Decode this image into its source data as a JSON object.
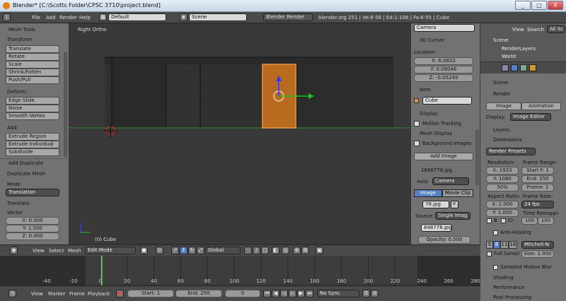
{
  "title": "Blender* [C:\\Scotts Folder\\CPSC 3710\\project.blend]",
  "win": {
    "min": "_",
    "max": "□",
    "close": "X"
  },
  "menu": [
    "File",
    "Add",
    "Render",
    "Help"
  ],
  "layout_name": "Default",
  "scene_name": "Scene",
  "engine": "Blender Render",
  "stats": "blender.org 251 | Ve:8-58 | Ed:1-106 | Fa:6-55 | Cube",
  "left": {
    "mesh_tools": "Mesh Tools",
    "transform_label": "Transform:",
    "transform": [
      "Translate",
      "Rotate",
      "Scale",
      "Shrink/Fatten",
      "Push/Pull"
    ],
    "deform_label": "Deform:",
    "deform": [
      "Edge Slide",
      "Noise",
      "Smooth Vertex"
    ],
    "add_label": "Add:",
    "add": [
      "Extrude Region",
      "Extrude Individual",
      "Subdivide"
    ],
    "op_header": "Add Duplicate",
    "op_name": "Duplicate Mesh",
    "mode_label": "Mode",
    "mode_val": "Translation",
    "translate_label": "Translate",
    "vector_label": "Vector",
    "vec": [
      "X: 0.000",
      "Y: 1.500",
      "Z: 0.000"
    ]
  },
  "viewport": {
    "view_name": "Right Ortho",
    "object_label": "(0) Cube"
  },
  "npanel": {
    "camera": "Camera",
    "cursor_header": "3D Cursor",
    "location_label": "Location:",
    "loc": [
      "X: 6.0832",
      "Y: 0.09046",
      "Z: -0.05249"
    ],
    "item_header": "Item",
    "item_name": "Cube",
    "display": "Display",
    "motion_tracking": "Motion Tracking",
    "mesh_display": "Mesh Display",
    "bg_images": "Background Images",
    "add_image": "Add Image",
    "img_file": "1848778.jpg",
    "axis_label": "Axis:",
    "axis_val": "Camera",
    "tab_image": "Image",
    "tab_movie": "Movie Clip",
    "img_short": "78.jpg",
    "img_f": "F",
    "source_label": "Source:",
    "source_val": "Single Imag",
    "img_path": "848778.jpg",
    "opacity": "Opacity: 0.500"
  },
  "outliner": {
    "view": "View",
    "search": "Search",
    "all": "All Sc",
    "scene": "Scene",
    "render_layers": "RenderLayers",
    "world": "World"
  },
  "props": {
    "context": "Scene",
    "render_header": "Render",
    "image_btn": "Image",
    "anim_btn": "Animation",
    "display_label": "Display:",
    "display_val": "Image Editor",
    "layers": "Layers",
    "dimensions": "Dimensions",
    "presets": "Render Presets",
    "resolution_label": "Resolution:",
    "frame_range_label": "Frame Range:",
    "res_x": "X: 1920",
    "res_y": "Y: 1080",
    "res_pct": "50%",
    "start": "Start F: 1",
    "end": "End: 250",
    "frame": "Frame: 1",
    "aspect_label": "Aspect Ratio:",
    "frame_rate_label": "Frame Rate:",
    "asp_x": "X: 1.000",
    "asp_y": "Y: 1.000",
    "fps": "24 fps",
    "time_remap_label": "Time Remappi",
    "b_label": "B",
    "cr_label": "Cr",
    "remap_old": "100",
    "remap_new": "100",
    "aa_header": "Anti-Aliasing",
    "aa_values": [
      "5",
      "8",
      "11",
      "16"
    ],
    "aa_filter": "Mitchell-N",
    "full_sample": "Full Sampl",
    "size": "Size: 1.000",
    "sampled_mb": "Sampled Motion Blur",
    "shading": "Shading",
    "performance": "Performance",
    "post": "Post Processing"
  },
  "header3d": {
    "view": "View",
    "select": "Select",
    "mesh": "Mesh",
    "mode": "Edit Mode",
    "orientation": "Global"
  },
  "timeline": {
    "ticks": [
      "-40",
      "-20",
      "0",
      "20",
      "40",
      "60",
      "80",
      "100",
      "120",
      "140",
      "160",
      "180",
      "200",
      "220",
      "240",
      "260",
      "280"
    ],
    "current_frame": 1
  },
  "tl_header": {
    "view": "View",
    "marker": "Marker",
    "frame": "Frame",
    "playback": "Playback",
    "start": "Start: 1",
    "end": "End: 250",
    "current": "0",
    "sync": "No Sync"
  }
}
